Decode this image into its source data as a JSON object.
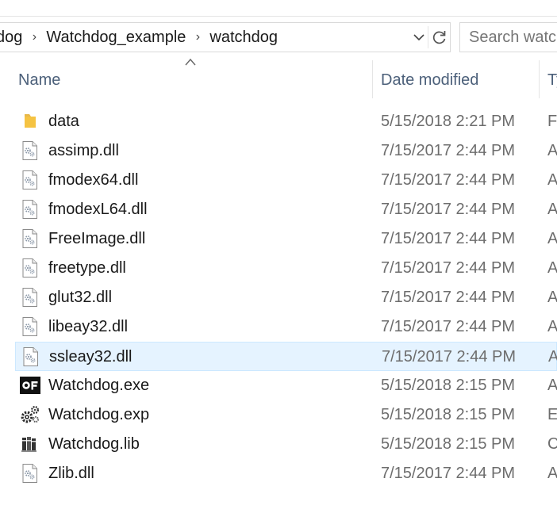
{
  "breadcrumb": {
    "items": [
      "dog",
      "Watchdog_example",
      "watchdog"
    ],
    "separator": "›"
  },
  "search": {
    "placeholder": "Search watchdog"
  },
  "columns": {
    "name": "Name",
    "date": "Date modified",
    "type": "Ty"
  },
  "colors": {
    "selected_row": "#e5f3ff",
    "header_text": "#4c607a",
    "folder": "#f5c342"
  },
  "files": [
    {
      "name": "data",
      "date": "5/15/2018 2:21 PM",
      "type": "Fi",
      "icon": "folder-icon"
    },
    {
      "name": "assimp.dll",
      "date": "7/15/2017 2:44 PM",
      "type": "A",
      "icon": "dll-file-icon"
    },
    {
      "name": "fmodex64.dll",
      "date": "7/15/2017 2:44 PM",
      "type": "A",
      "icon": "dll-file-icon"
    },
    {
      "name": "fmodexL64.dll",
      "date": "7/15/2017 2:44 PM",
      "type": "A",
      "icon": "dll-file-icon"
    },
    {
      "name": "FreeImage.dll",
      "date": "7/15/2017 2:44 PM",
      "type": "A",
      "icon": "dll-file-icon"
    },
    {
      "name": "freetype.dll",
      "date": "7/15/2017 2:44 PM",
      "type": "A",
      "icon": "dll-file-icon"
    },
    {
      "name": "glut32.dll",
      "date": "7/15/2017 2:44 PM",
      "type": "A",
      "icon": "dll-file-icon"
    },
    {
      "name": "libeay32.dll",
      "date": "7/15/2017 2:44 PM",
      "type": "A",
      "icon": "dll-file-icon"
    },
    {
      "name": "ssleay32.dll",
      "date": "7/15/2017 2:44 PM",
      "type": "A",
      "icon": "dll-file-icon",
      "selected": true
    },
    {
      "name": "Watchdog.exe",
      "date": "5/15/2018 2:15 PM",
      "type": "A",
      "icon": "openframeworks-app-icon"
    },
    {
      "name": "Watchdog.exp",
      "date": "5/15/2018 2:15 PM",
      "type": "E",
      "icon": "exp-file-gears-icon"
    },
    {
      "name": "Watchdog.lib",
      "date": "5/15/2018 2:15 PM",
      "type": "C",
      "icon": "lib-file-books-icon"
    },
    {
      "name": "Zlib.dll",
      "date": "7/15/2017 2:44 PM",
      "type": "A",
      "icon": "dll-file-icon"
    }
  ]
}
